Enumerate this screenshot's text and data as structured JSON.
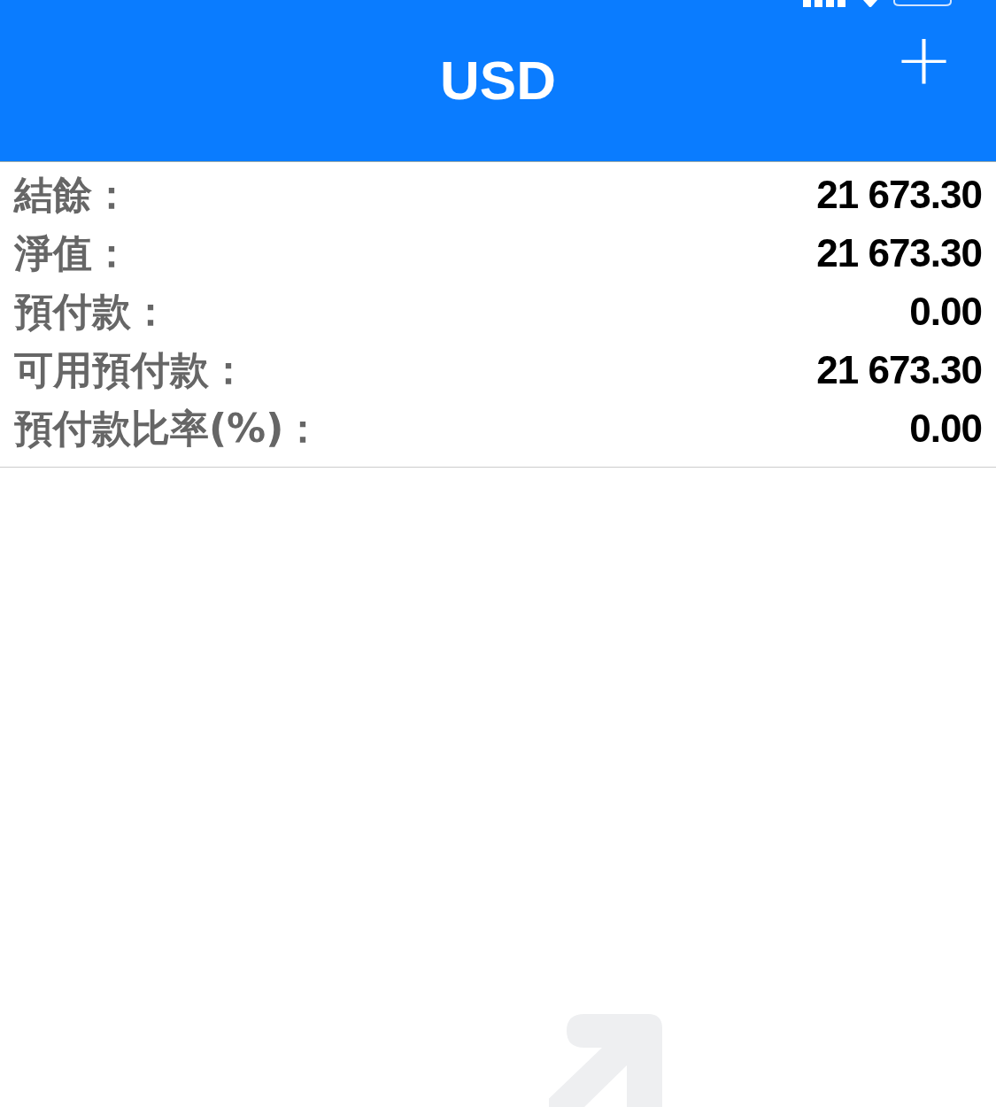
{
  "header": {
    "title": "USD",
    "add_button": "+"
  },
  "rows": [
    {
      "label": "結餘：",
      "value": "21 673.30"
    },
    {
      "label": "淨值：",
      "value": "21 673.30"
    },
    {
      "label": "預付款：",
      "value": "0.00"
    },
    {
      "label": "可用預付款：",
      "value": "21 673.30"
    },
    {
      "label": "預付款比率(%)：",
      "value": "0.00"
    }
  ]
}
